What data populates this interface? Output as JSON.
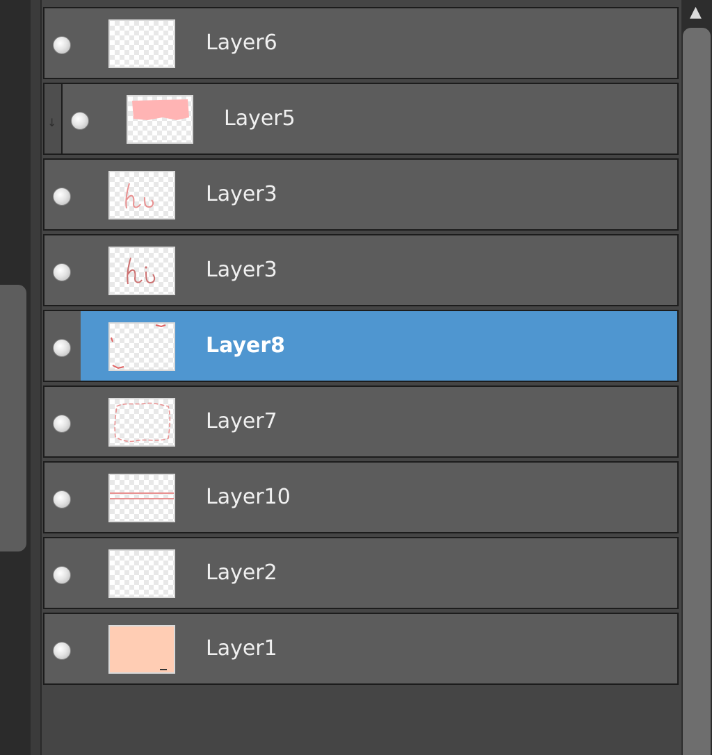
{
  "layers": [
    {
      "name": "Layer6",
      "thumbnail": "transparent-empty"
    },
    {
      "name": "Layer5",
      "thumbnail": "pink-brush-stroke",
      "clipped": true
    },
    {
      "name": "Layer3",
      "thumbnail": "hi-lettering"
    },
    {
      "name": "Layer3",
      "thumbnail": "hi-lettering-dark"
    },
    {
      "name": "Layer8",
      "thumbnail": "corner-marks",
      "selected": true
    },
    {
      "name": "Layer7",
      "thumbnail": "frame-outline"
    },
    {
      "name": "Layer10",
      "thumbnail": "horizontal-lines"
    },
    {
      "name": "Layer2",
      "thumbnail": "transparent-empty"
    },
    {
      "name": "Layer1",
      "thumbnail": "peach-fill",
      "fill_color": "#ffcdb4"
    }
  ],
  "colors": {
    "selection": "#4f96d0",
    "row_background": "#5c5c5c",
    "panel_background": "#454545",
    "pink_stroke": "#ffb4b4",
    "peach_fill": "#ffcdb4"
  },
  "scrollbar": {
    "up_arrow_icon": "triangle-up-icon"
  }
}
